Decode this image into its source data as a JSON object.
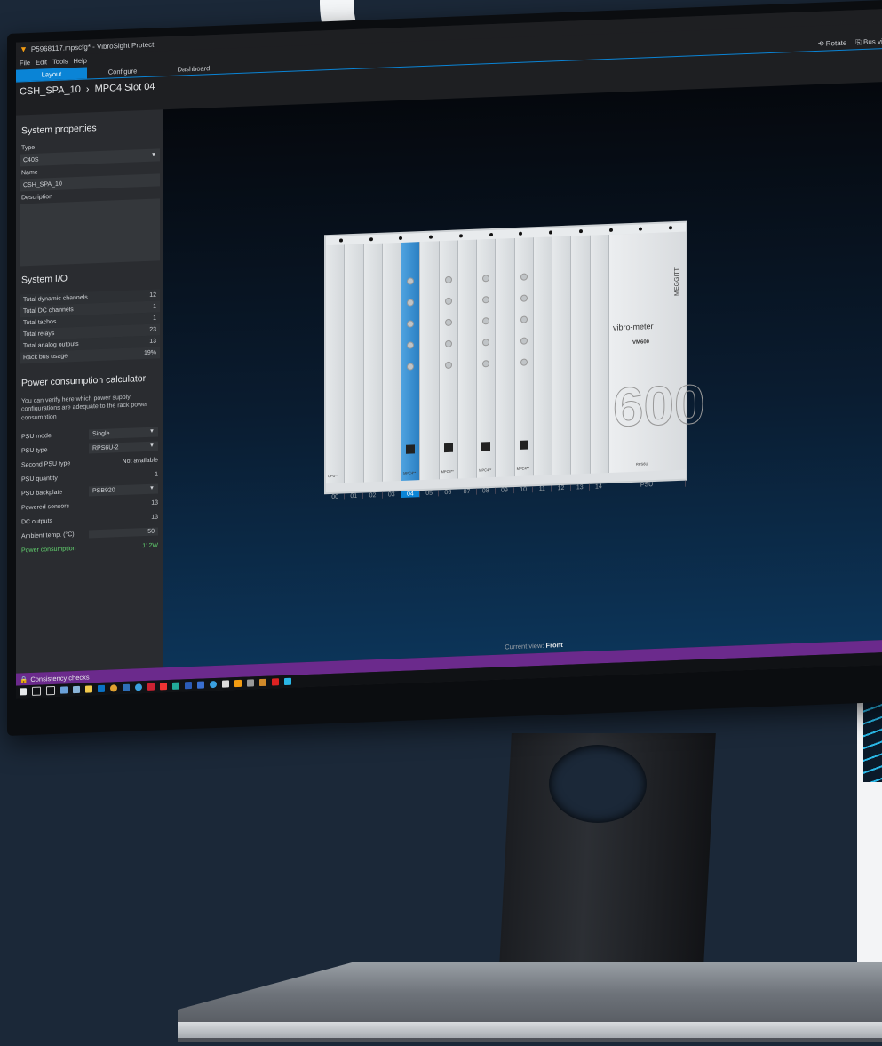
{
  "app": {
    "window_title": "P5968117.mpscfg* - VibroSight Protect",
    "menu": [
      "File",
      "Edit",
      "Tools",
      "Help"
    ],
    "tabs": [
      {
        "label": "Layout",
        "active": true
      },
      {
        "label": "Configure",
        "active": false
      },
      {
        "label": "Dashboard",
        "active": false
      }
    ],
    "toolbar": {
      "rotate": "Rotate",
      "bus_view": "Bus view"
    },
    "breadcrumb": {
      "system": "CSH_SPA_10",
      "separator": "›",
      "slot": "MPC4 Slot 04"
    }
  },
  "sidebar": {
    "system_properties": {
      "title": "System properties",
      "type_label": "Type",
      "type_value": "C40S",
      "name_label": "Name",
      "name_value": "CSH_SPA_10",
      "description_label": "Description"
    },
    "system_io": {
      "title": "System I/O",
      "rows": [
        {
          "label": "Total dynamic channels",
          "value": "12"
        },
        {
          "label": "Total DC channels",
          "value": "1"
        },
        {
          "label": "Total tachos",
          "value": "1"
        },
        {
          "label": "Total relays",
          "value": "23"
        },
        {
          "label": "Total analog outputs",
          "value": "13"
        },
        {
          "label": "Rack bus usage",
          "value": "19%"
        }
      ]
    },
    "power": {
      "title": "Power consumption calculator",
      "note": "You can verify here which power supply configurations are adequate to the rack power consumption",
      "psu_mode_label": "PSU mode",
      "psu_mode_value": "Single",
      "psu_type_label": "PSU type",
      "psu_type_value": "RPS6U-2",
      "second_psu_label": "Second PSU type",
      "second_psu_value": "Not available",
      "psu_qty_label": "PSU quantity",
      "psu_qty_value": "1",
      "psu_backplate_label": "PSU backplate",
      "psu_backplate_value": "PSB920",
      "powered_sensors_label": "Powered sensors",
      "powered_sensors_value": "13",
      "dc_outputs_label": "DC outputs",
      "dc_outputs_value": "13",
      "ambient_label": "Ambient temp. (°C)",
      "ambient_value": "50",
      "consumption_label": "Power consumption",
      "consumption_value": "112W"
    }
  },
  "viewport": {
    "current_view_label": "Current view:",
    "current_view_value": "Front",
    "slot_numbers": [
      "00",
      "01",
      "02",
      "03",
      "04",
      "05",
      "06",
      "07",
      "08",
      "09",
      "10",
      "11",
      "12",
      "13",
      "14"
    ],
    "psu_label": "PSU",
    "psu_brand": "vibro-meter",
    "psu_model": "VM600",
    "psu_maker": "MEGGITT",
    "psu_digits": "600",
    "module_labels": [
      "CPU**",
      "MPC4**",
      "MPC4**",
      "MPC4**",
      "MPC4**",
      "RPS6U"
    ]
  },
  "status": {
    "consistency": "Consistency checks"
  },
  "taskbar_icons": [
    "start-icon",
    "search-icon",
    "taskview-icon",
    "app-icon",
    "app-icon",
    "explorer-icon",
    "outlook-icon",
    "chrome-icon",
    "app-icon",
    "edge-icon",
    "app-icon",
    "app-icon",
    "app-icon",
    "word-icon",
    "app-icon",
    "edge-icon",
    "app-icon",
    "vibrosight-icon",
    "app-icon",
    "app-icon",
    "acrobat-icon",
    "vibrosight-icon"
  ],
  "colors": {
    "accent": "#0a84d6",
    "status_bar": "#6b2a8c",
    "power_ok": "#62d36f"
  }
}
